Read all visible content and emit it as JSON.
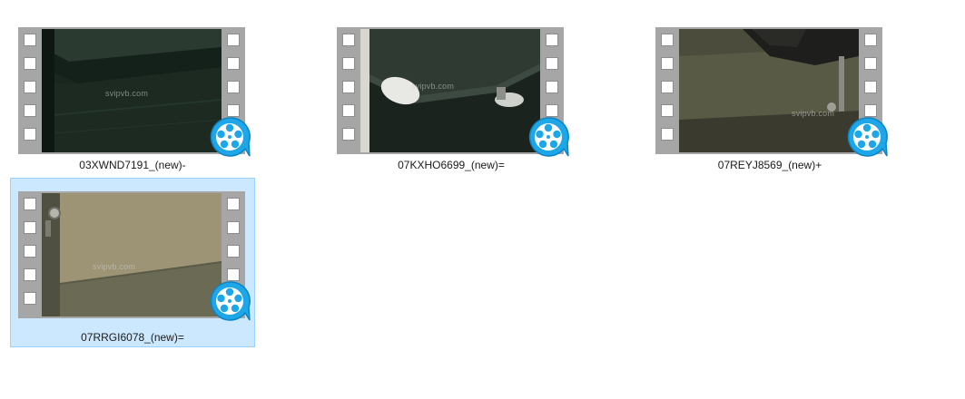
{
  "window": {
    "view": "large-icons"
  },
  "files": [
    {
      "name": "03XWND7191_(new)-",
      "watermark": "svipvb.com",
      "selected": false,
      "icon": "video-reel-icon"
    },
    {
      "name": "07KXHO6699_(new)=",
      "watermark": "svipvb.com",
      "selected": false,
      "icon": "video-reel-icon"
    },
    {
      "name": "07REYJ8569_(new)+",
      "watermark": "svipvb.com",
      "selected": false,
      "icon": "video-reel-icon"
    },
    {
      "name": "07RRGI6078_(new)=",
      "watermark": "svipvb.com",
      "selected": true,
      "icon": "video-reel-icon"
    }
  ],
  "colors": {
    "selection_bg": "#cce8ff",
    "selection_border": "#99d1ff",
    "reel_blue": "#1ea7e8"
  }
}
